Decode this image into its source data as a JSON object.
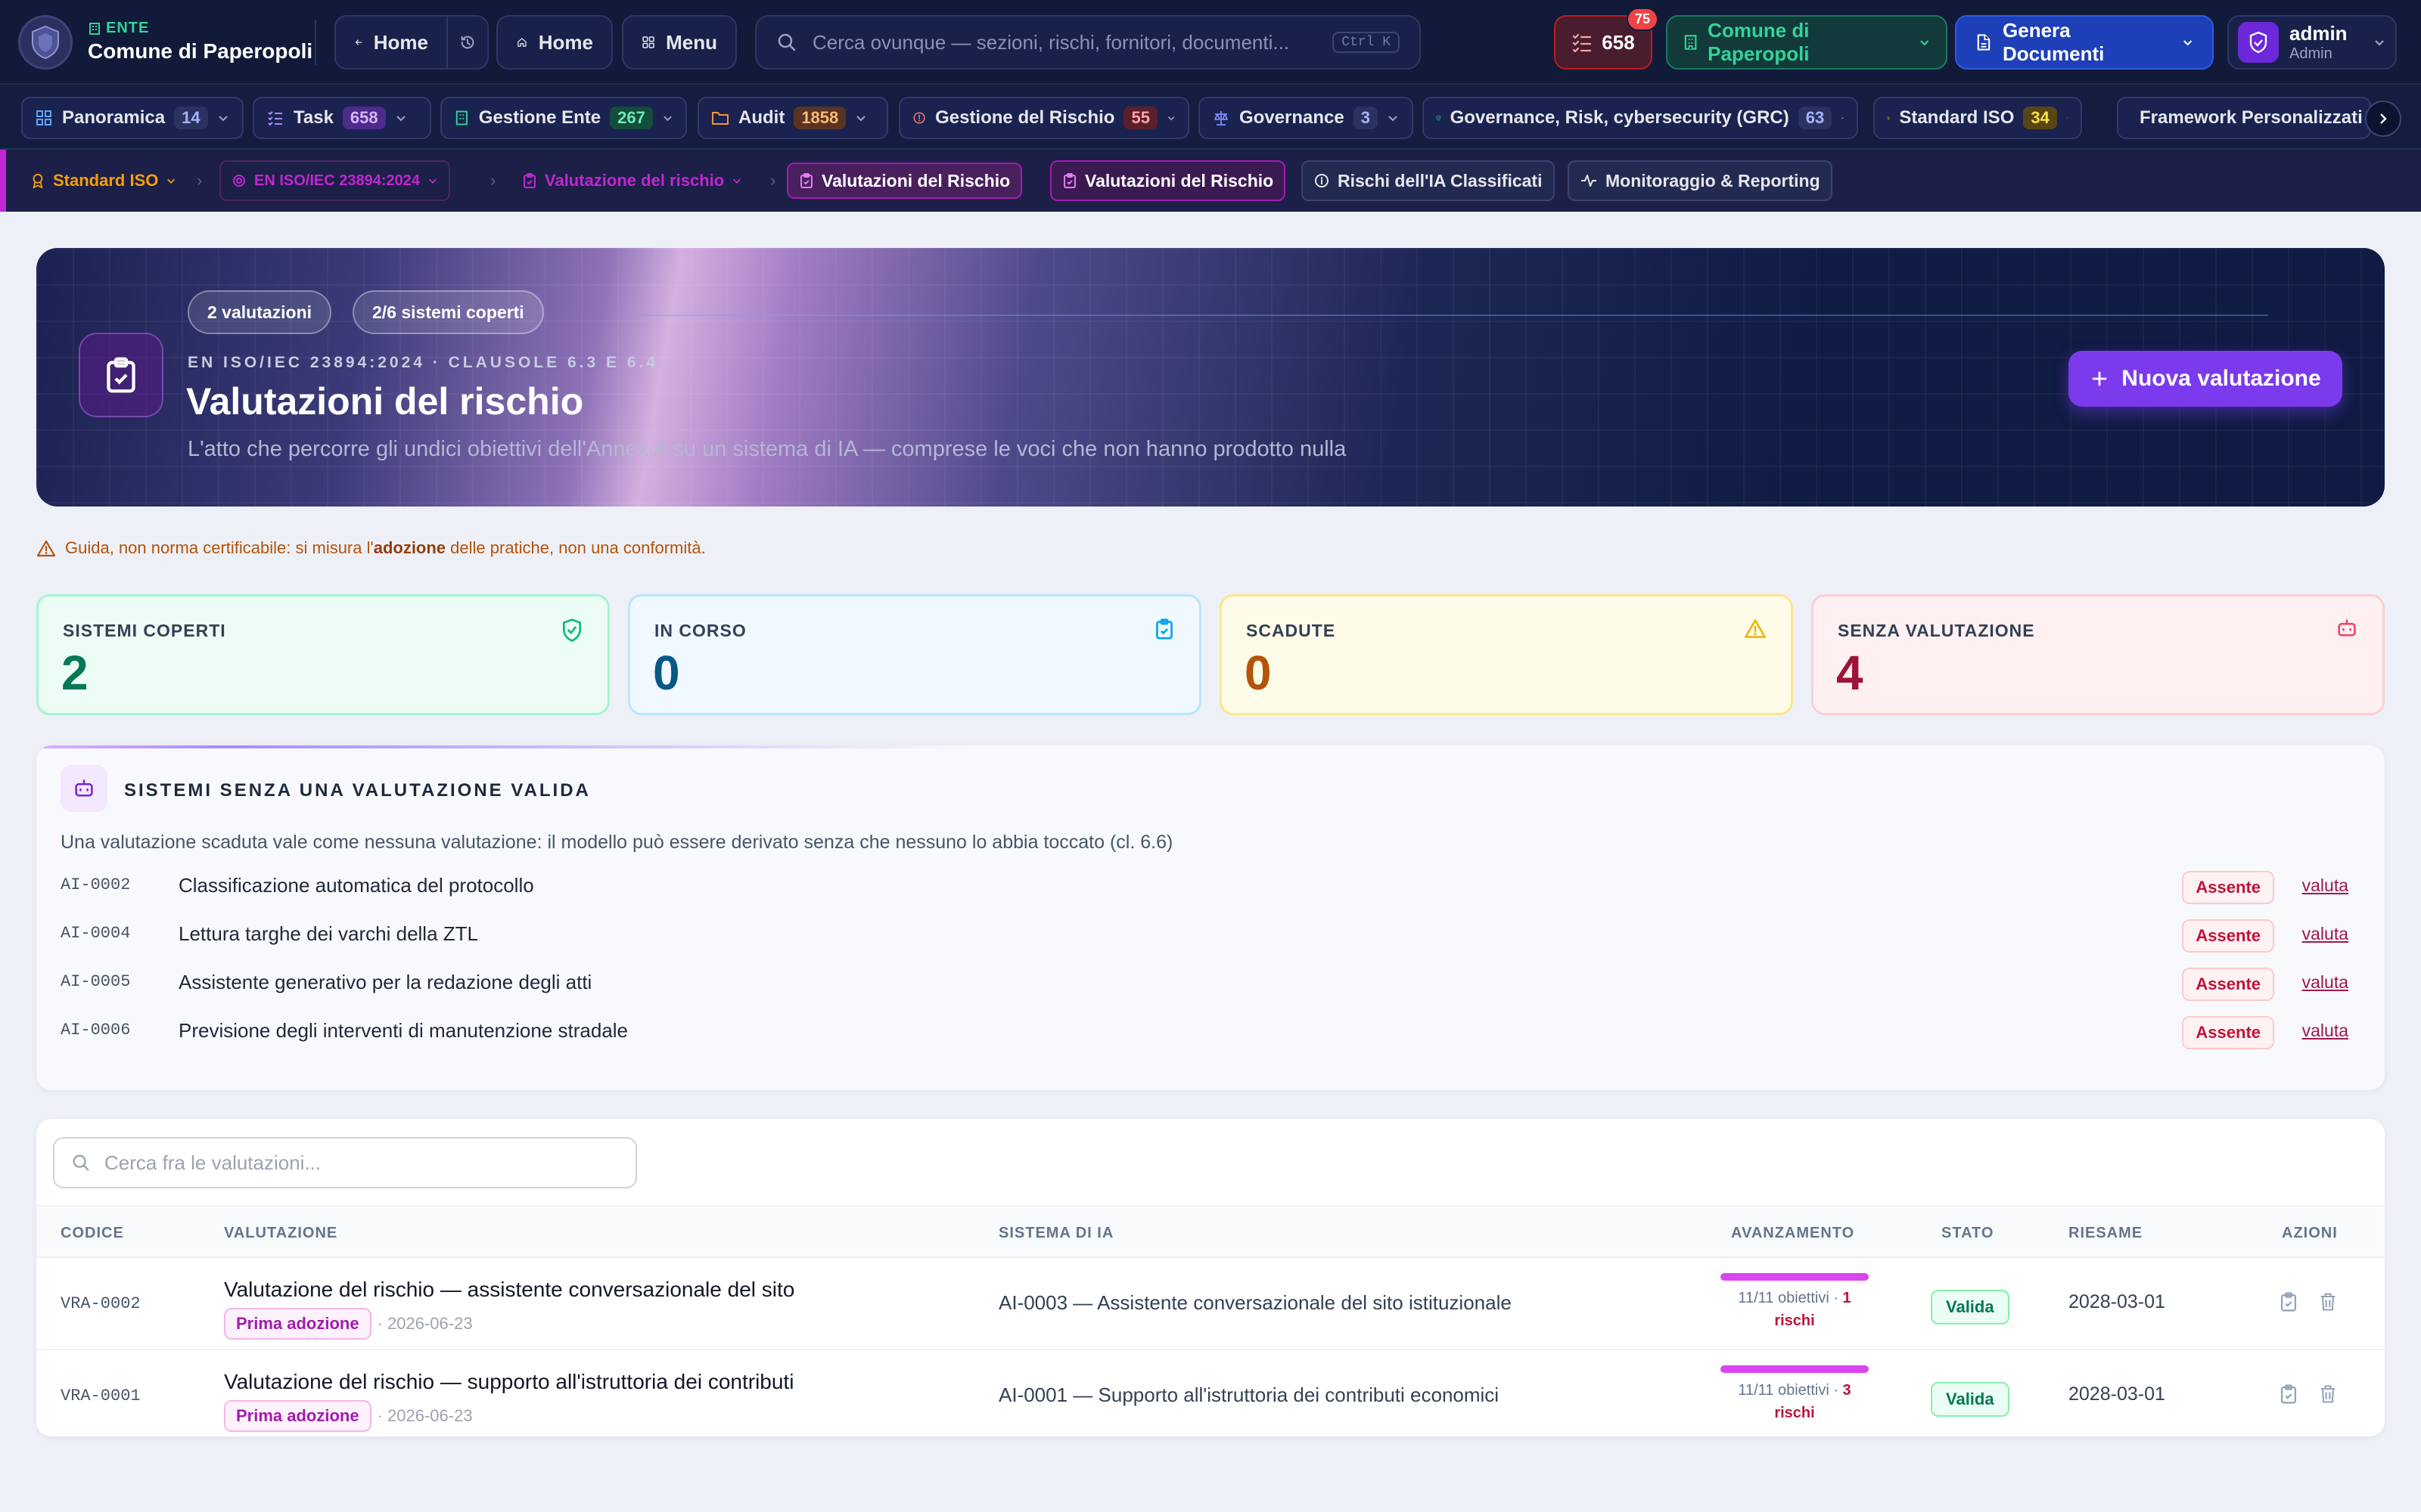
{
  "header": {
    "ente_kicker": "ENTE",
    "ente_name": "Comune di Paperopoli",
    "back_label": "Home",
    "home_label": "Home",
    "menu_label": "Menu",
    "search_placeholder": "Cerca ovunque — sezioni, rischi, fornitori, documenti...",
    "search_shortcut": "Ctrl K",
    "tasks_count": "658",
    "tasks_badge": "75",
    "comune_selector": "Comune di Paperopoli",
    "generate_docs": "Genera Documenti",
    "user_name": "admin",
    "user_role": "Admin"
  },
  "modules": [
    {
      "label": "Panoramica",
      "count": "14"
    },
    {
      "label": "Task",
      "count": "658"
    },
    {
      "label": "Gestione Ente",
      "count": "267"
    },
    {
      "label": "Audit",
      "count": "1858"
    },
    {
      "label": "Gestione del Rischio",
      "count": "55"
    },
    {
      "label": "Governance",
      "count": "3"
    },
    {
      "label": "Governance, Risk, cybersecurity (GRC)",
      "count": "63"
    },
    {
      "label": "Standard ISO",
      "count": "34"
    },
    {
      "label": "Framework Personalizzati",
      "count": ""
    }
  ],
  "breadcrumb": {
    "items": [
      "Standard ISO",
      "EN ISO/IEC 23894:2024",
      "Valutazione del rischio",
      "Valutazioni del Rischio"
    ],
    "tabs": [
      "Valutazioni del Rischio",
      "Rischi dell'IA Classificati",
      "Monitoraggio & Reporting"
    ]
  },
  "hero": {
    "chip_valutazioni": "2 valutazioni",
    "chip_sistemi": "2/6 sistemi coperti",
    "kicker": "EN ISO/IEC 23894:2024 · CLAUSOLE 6.3 E 6.4",
    "title": "Valutazioni del rischio",
    "subtitle": "L'atto che percorre gli undici obiettivi dell'Annex A su un sistema di IA — comprese le voci che non hanno prodotto nulla",
    "new_button": "Nuova valutazione"
  },
  "guide": {
    "prefix": "Guida, non norma certificabile: si misura l'",
    "bold": "adozione",
    "suffix": " delle pratiche, non una conformità."
  },
  "stats": [
    {
      "label": "SISTEMI COPERTI",
      "value": "2"
    },
    {
      "label": "IN CORSO",
      "value": "0"
    },
    {
      "label": "SCADUTE",
      "value": "0"
    },
    {
      "label": "SENZA VALUTAZIONE",
      "value": "4"
    }
  ],
  "no_valid": {
    "title": "SISTEMI SENZA UNA VALUTAZIONE VALIDA",
    "subtitle": "Una valutazione scaduta vale come nessuna valutazione: il modello può essere derivato senza che nessuno lo abbia toccato (cl. 6.6)",
    "status_label": "Assente",
    "action_label": "valuta",
    "systems": [
      {
        "code": "AI-0002",
        "name": "Classificazione automatica del protocollo"
      },
      {
        "code": "AI-0004",
        "name": "Lettura targhe dei varchi della ZTL"
      },
      {
        "code": "AI-0005",
        "name": "Assistente generativo per la redazione degli atti"
      },
      {
        "code": "AI-0006",
        "name": "Previsione degli interventi di manutenzione stradale"
      }
    ]
  },
  "table": {
    "search_placeholder": "Cerca fra le valutazioni...",
    "columns": [
      "CODICE",
      "VALUTAZIONE",
      "SISTEMA DI IA",
      "AVANZAMENTO",
      "STATO",
      "RIESAME",
      "AZIONI"
    ],
    "rows": [
      {
        "code": "VRA-0002",
        "title": "Valutazione del rischio — assistente conversazionale del sito",
        "badge": "Prima adozione",
        "date": "· 2026-06-23",
        "system": "AI-0003 — Assistente conversazionale del sito istituzionale",
        "progress_text": "11/11 obiettivi ·",
        "risks_num": "1",
        "risks_word": "rischi",
        "progress": 1.0,
        "status": "Valida",
        "review": "2028-03-01"
      },
      {
        "code": "VRA-0001",
        "title": "Valutazione del rischio — supporto all'istruttoria dei contributi",
        "badge": "Prima adozione",
        "date": "· 2026-06-23",
        "system": "AI-0001 — Supporto all'istruttoria dei contributi economici",
        "progress_text": "11/11 obiettivi ·",
        "risks_num": "3",
        "risks_word": "rischi",
        "progress": 1.0,
        "status": "Valida",
        "review": "2028-03-01"
      }
    ]
  },
  "colors": {
    "accent": "#7c3aed",
    "magenta": "#d946ef",
    "success": "#059669",
    "danger": "#be123c",
    "warning": "#b45309"
  }
}
